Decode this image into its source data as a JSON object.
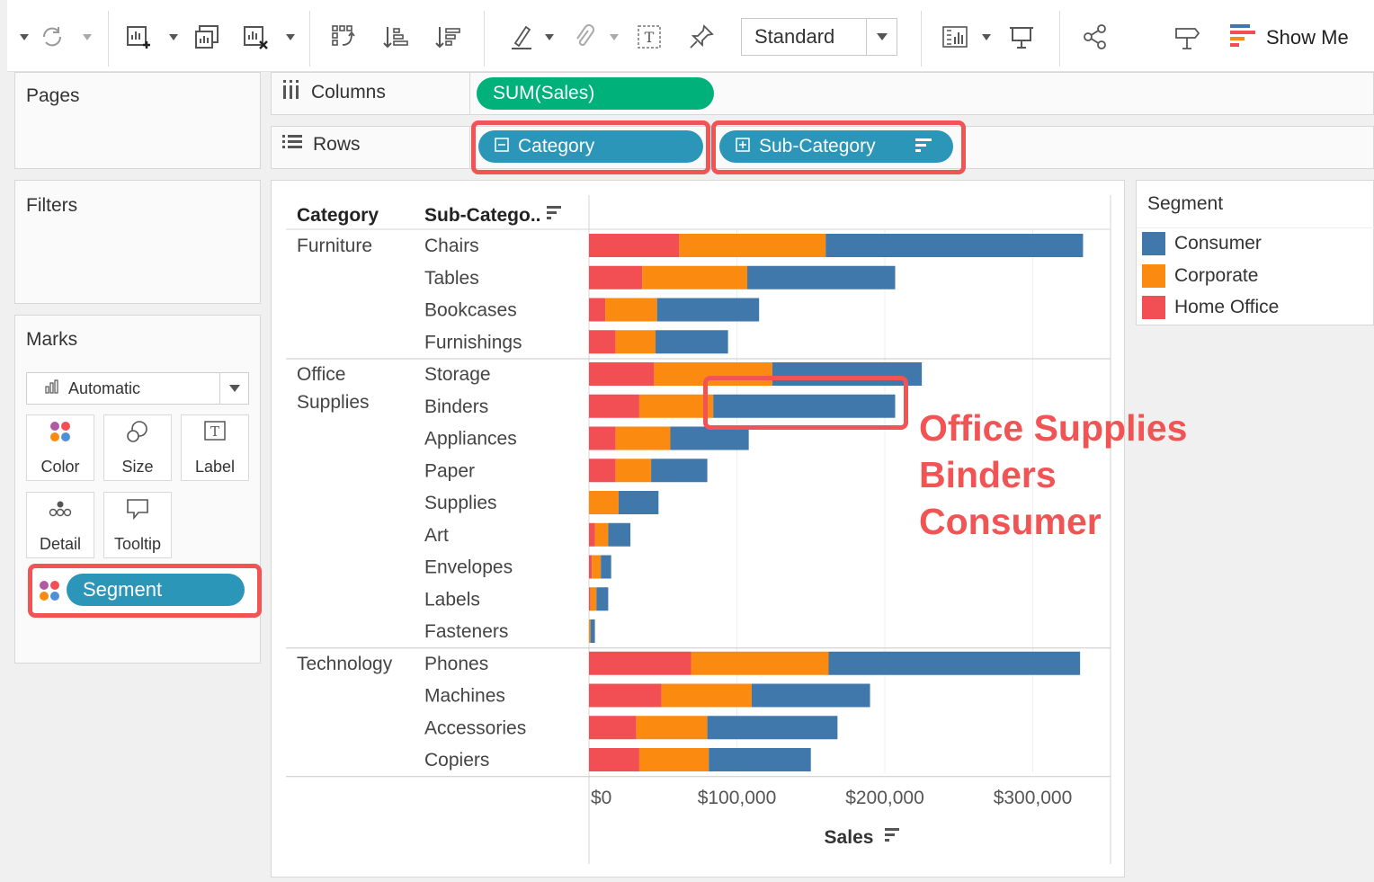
{
  "toolbar": {
    "standard_label": "Standard",
    "show_me_label": "Show Me",
    "icons": [
      "undo-arrow-icon",
      "refresh-icon",
      "new-worksheet-icon",
      "duplicate-sheet-icon",
      "clear-sheet-icon",
      "swap-rows-columns-icon",
      "sort-ascending-icon",
      "sort-descending-icon",
      "highlight-pen-icon",
      "paperclip-icon",
      "text-box-icon",
      "pin-icon",
      "fit-dropdown-icon",
      "presentation-icon",
      "share-icon",
      "signpost-icon",
      "show-me-icon"
    ]
  },
  "panels": {
    "pages_title": "Pages",
    "filters_title": "Filters",
    "marks_title": "Marks"
  },
  "marks": {
    "type_label": "Automatic",
    "buttons": {
      "color": "Color",
      "size": "Size",
      "label": "Label",
      "detail": "Detail",
      "tooltip": "Tooltip"
    },
    "pill_label": "Segment"
  },
  "shelves": {
    "columns_label": "Columns",
    "rows_label": "Rows",
    "columns_pill": "SUM(Sales)",
    "rows_pill_1": "Category",
    "rows_pill_2": "Sub-Category"
  },
  "colors": {
    "consumer": "#4178ab",
    "corporate": "#fb8a11",
    "home_office": "#f24f55",
    "highlight": "#f05454",
    "green_pill": "#00b27a",
    "blue_pill": "#2b96b8"
  },
  "legend": {
    "title": "Segment",
    "items": [
      "Consumer",
      "Corporate",
      "Home Office"
    ]
  },
  "annotation": {
    "line1": "Office Supplies",
    "line2": "Binders",
    "line3": "Consumer"
  },
  "chart_data": {
    "type": "bar",
    "orientation": "horizontal",
    "stacked": true,
    "header_category": "Category",
    "header_subcategory": "Sub-Catego..",
    "xlabel": "Sales",
    "xlim": [
      0,
      350000
    ],
    "xticks": [
      "$0",
      "$100,000",
      "$200,000",
      "$300,000"
    ],
    "xtick_values": [
      0,
      100000,
      200000,
      300000
    ],
    "groups": [
      {
        "category": "Furniture",
        "subcategories": [
          "Chairs",
          "Tables",
          "Bookcases",
          "Furnishings"
        ]
      },
      {
        "category": "Office Supplies",
        "subcategories": [
          "Storage",
          "Binders",
          "Appliances",
          "Paper",
          "Supplies",
          "Art",
          "Envelopes",
          "Labels",
          "Fasteners"
        ]
      },
      {
        "category": "Technology",
        "subcategories": [
          "Phones",
          "Machines",
          "Accessories",
          "Copiers"
        ]
      }
    ],
    "series": [
      {
        "name": "Home Office",
        "values": [
          61000,
          36000,
          11000,
          18000,
          44000,
          34000,
          18000,
          18000,
          0,
          4000,
          2000,
          1000,
          0,
          69000,
          49000,
          32000,
          34000
        ]
      },
      {
        "name": "Corporate",
        "values": [
          99000,
          71000,
          35000,
          27000,
          80000,
          50000,
          37000,
          24000,
          20000,
          9000,
          6000,
          4000,
          1000,
          93000,
          61000,
          48000,
          47000
        ]
      },
      {
        "name": "Consumer",
        "values": [
          174000,
          100000,
          69000,
          49000,
          101000,
          123000,
          53000,
          38000,
          27000,
          15000,
          7000,
          8000,
          3000,
          170000,
          80000,
          88000,
          69000
        ]
      }
    ]
  }
}
